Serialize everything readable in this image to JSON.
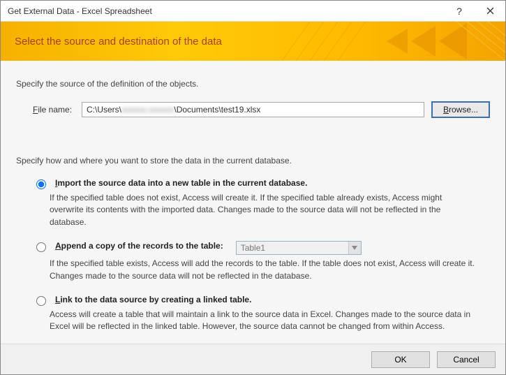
{
  "window": {
    "title": "Get External Data - Excel Spreadsheet"
  },
  "banner": {
    "title": "Select the source and destination of the data"
  },
  "source": {
    "intro": "Specify the source of the definition of the objects.",
    "file_label_pre": "F",
    "file_label_post": "ile name:",
    "file_value": "C:\\Users\\",
    "file_value_blur": "xxxxxx.xxxxxx",
    "file_value_tail": "\\Documents\\test19.xlsx",
    "browse_label": "B",
    "browse_label_post": "rowse..."
  },
  "store": {
    "intro": "Specify how and where you want to store the data in the current database.",
    "opt1_label_pre": "I",
    "opt1_label_post": "mport the source data into a new table in the current database.",
    "opt1_desc": "If the specified table does not exist, Access will create it. If the specified table already exists, Access might overwrite its contents with the imported data. Changes made to the source data will not be reflected in the database.",
    "opt2_label_pre": "A",
    "opt2_label_post": "ppend a copy of the records to the table:",
    "opt2_table": "Table1",
    "opt2_desc": "If the specified table exists, Access will add the records to the table. If the table does not exist, Access will create it. Changes made to the source data will not be reflected in the database.",
    "opt3_label_pre": "L",
    "opt3_label_post": "ink to the data source by creating a linked table.",
    "opt3_desc": "Access will create a table that will maintain a link to the source data in Excel. Changes made to the source data in Excel will be reflected in the linked table. However, the source data cannot be changed from within Access."
  },
  "footer": {
    "ok": "OK",
    "cancel": "Cancel"
  }
}
